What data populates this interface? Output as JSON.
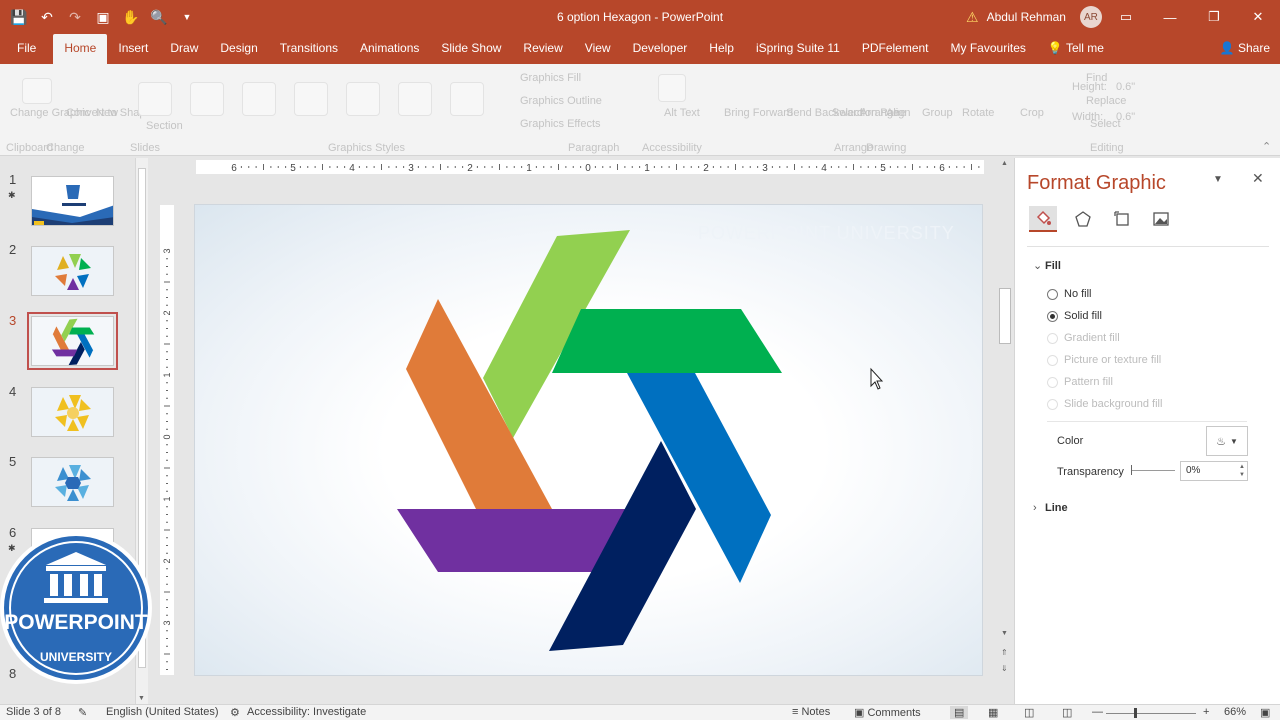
{
  "app": {
    "title": "6 option Hexagon  -  PowerPoint",
    "user": "Abdul Rehman",
    "user_initials": "AR",
    "accent": "#b7472a"
  },
  "qat": [
    "save-icon",
    "undo-icon",
    "redo-icon",
    "present-icon",
    "touch-mode-icon",
    "print-preview-icon",
    "customize-icon"
  ],
  "tabs": [
    "File",
    "Home",
    "Insert",
    "Draw",
    "Design",
    "Transitions",
    "Animations",
    "Slide Show",
    "Review",
    "View",
    "Developer",
    "Help",
    "iSpring Suite 11",
    "PDFelement",
    "My Favourites"
  ],
  "active_tab": "Home",
  "tell_me": "Tell me",
  "share": "Share",
  "ribbon": {
    "change_graphic": "Change Graphic",
    "convert_to_shape": "Convert to Shape",
    "new": "New",
    "section": "Section",
    "change_group": "Change",
    "graphics_fill": "Graphics Fill",
    "graphics_outline": "Graphics Outline",
    "graphics_effects": "Graphics Effects",
    "graphics_styles": "Graphics Styles",
    "paragraph": "Paragraph",
    "accessibility": "Accessibility",
    "alt_text": "Alt Text",
    "bring_forward": "Bring Forward",
    "send_backward": "Send Backward",
    "selection_pane": "Selection Pane",
    "arrange": "Arrange",
    "align": "Align",
    "group": "Group",
    "rotate": "Rotate",
    "arrange_group": "Arrange",
    "drawing_group": "Drawing",
    "crop": "Crop",
    "height_label": "Height:",
    "height_value": "0.6\"",
    "width_label": "Width:",
    "width_value": "0.6\"",
    "find": "Find",
    "replace": "Replace",
    "select": "Select",
    "editing": "Editing",
    "clipboard": "Clipboard",
    "slides": "Slides"
  },
  "thumbnails": [
    {
      "num": "1",
      "star": true
    },
    {
      "num": "2",
      "star": false
    },
    {
      "num": "3",
      "star": false,
      "selected": true
    },
    {
      "num": "4",
      "star": false
    },
    {
      "num": "5",
      "star": false
    },
    {
      "num": "6",
      "star": true
    },
    {
      "num": "8",
      "star": false
    }
  ],
  "ruler": {
    "h_labels": [
      "6",
      "5",
      "4",
      "3",
      "2",
      "1",
      "0",
      "1",
      "2",
      "3",
      "4",
      "5",
      "6"
    ],
    "v_labels": [
      "3",
      "2",
      "1",
      "0",
      "1",
      "2",
      "3"
    ]
  },
  "slide": {
    "watermark": "POWERPOINT UNIVERSITY",
    "colors": {
      "light_green": "#92d050",
      "green": "#00b050",
      "blue": "#0070c0",
      "navy": "#002060",
      "purple": "#7030a0",
      "orange": "#e07b39"
    }
  },
  "logo": {
    "brand": "POWERPOINT",
    "sub": "UNIVERSITY",
    "bg": "#2a6ab7"
  },
  "pane": {
    "title": "Format Graphic",
    "icons": [
      "fill-line-icon",
      "effects-icon",
      "size-properties-icon",
      "picture-icon"
    ],
    "fill_section": "Fill",
    "options": [
      {
        "label": "No fill",
        "checked": false,
        "enabled": true
      },
      {
        "label": "Solid fill",
        "checked": true,
        "enabled": true
      },
      {
        "label": "Gradient fill",
        "checked": false,
        "enabled": false
      },
      {
        "label": "Picture or texture fill",
        "checked": false,
        "enabled": false
      },
      {
        "label": "Pattern fill",
        "checked": false,
        "enabled": false
      },
      {
        "label": "Slide background fill",
        "checked": false,
        "enabled": false
      }
    ],
    "color_label": "Color",
    "transparency_label": "Transparency",
    "transparency_value": "0%",
    "line_section": "Line"
  },
  "status": {
    "slide": "Slide 3 of 8",
    "language": "English (United States)",
    "accessibility": "Accessibility: Investigate",
    "notes": "Notes",
    "comments": "Comments",
    "zoom": "66%"
  }
}
